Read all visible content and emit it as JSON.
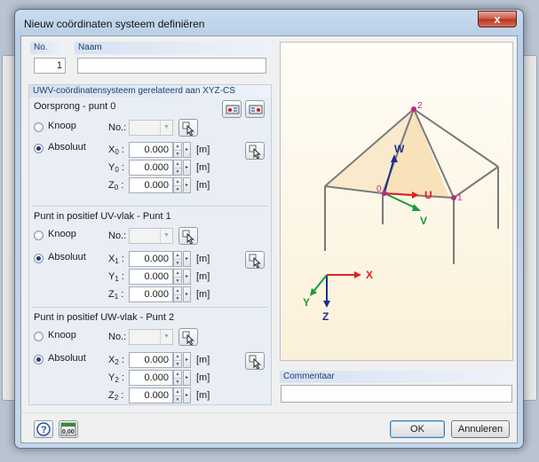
{
  "window": {
    "title": "Nieuw coördinaten systeem definiëren",
    "close_glyph": "x"
  },
  "header": {
    "no_label": "No.",
    "no_value": "1",
    "name_label": "Naam",
    "name_value": ""
  },
  "cs_section": {
    "title": "UWV-coördinatensysteem gerelateerd aan XYZ-CS"
  },
  "groups": [
    {
      "title": "Oorsprong - punt 0",
      "knoop_label": "Knoop",
      "absoluut_label": "Absoluut",
      "no_label": "No.:",
      "selected": "Absoluut",
      "coords": [
        {
          "axis": "X",
          "sub": "0",
          "value": "0.000",
          "unit": "[m]"
        },
        {
          "axis": "Y",
          "sub": "0",
          "value": "0.000",
          "unit": "[m]"
        },
        {
          "axis": "Z",
          "sub": "0",
          "value": "0.000",
          "unit": "[m]"
        }
      ]
    },
    {
      "title": "Punt in positief UV-vlak - Punt 1",
      "knoop_label": "Knoop",
      "absoluut_label": "Absoluut",
      "no_label": "No.:",
      "selected": "Absoluut",
      "coords": [
        {
          "axis": "X",
          "sub": "1",
          "value": "0.000",
          "unit": "[m]"
        },
        {
          "axis": "Y",
          "sub": "1",
          "value": "0.000",
          "unit": "[m]"
        },
        {
          "axis": "Z",
          "sub": "1",
          "value": "0.000",
          "unit": "[m]"
        }
      ]
    },
    {
      "title": "Punt in positief UW-vlak - Punt 2",
      "knoop_label": "Knoop",
      "absoluut_label": "Absoluut",
      "no_label": "No.:",
      "selected": "Absoluut",
      "coords": [
        {
          "axis": "X",
          "sub": "2",
          "value": "0.000",
          "unit": "[m]"
        },
        {
          "axis": "Y",
          "sub": "2",
          "value": "0.000",
          "unit": "[m]"
        },
        {
          "axis": "Z",
          "sub": "2",
          "value": "0.000",
          "unit": "[m]"
        }
      ]
    }
  ],
  "preview": {
    "labels": {
      "point2": "2",
      "point0": "0",
      "point1": "1",
      "u": "U",
      "v": "V",
      "w": "W",
      "x": "X",
      "y": "Y",
      "z": "Z"
    },
    "colors": {
      "x_axis": "#e02020",
      "y_axis": "#1a9a3a",
      "z_axis": "#1c2f8f",
      "frame": "#7a7a7a",
      "point": "#c0288c",
      "plane": "#f5d7a0"
    }
  },
  "comment": {
    "label": "Commentaar",
    "value": ""
  },
  "footer": {
    "ok_label": "OK",
    "cancel_label": "Annuleren",
    "units_badge": "0,00"
  }
}
